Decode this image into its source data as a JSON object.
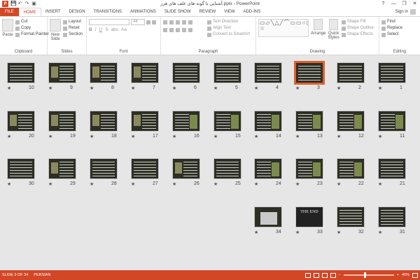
{
  "window": {
    "title": "آشنایی با گونه های علف های هرز.pptx - PowerPoint",
    "help": "?",
    "minimize": "—",
    "restore": "❐",
    "close": "✕"
  },
  "qat": {
    "save": "💾",
    "undo": "↶",
    "redo": "↷",
    "present": "▣"
  },
  "tabs": [
    "FILE",
    "HOME",
    "INSERT",
    "DESIGN",
    "TRANSITIONS",
    "ANIMATIONS",
    "SLIDE SHOW",
    "REVIEW",
    "VIEW",
    "ADD-INS"
  ],
  "active_tab": "HOME",
  "account": {
    "label": "Sign in"
  },
  "ribbon": {
    "clipboard": {
      "label": "Clipboard",
      "paste": "Paste",
      "cut": "Cut",
      "copy": "Copy",
      "format_painter": "Format Painter"
    },
    "slides": {
      "label": "Slides",
      "new_slide_1": "New",
      "new_slide_2": "Slide",
      "layout": "Layout",
      "reset": "Reset",
      "section": "Section"
    },
    "font": {
      "label": "Font",
      "size": "44",
      "bold": "B",
      "italic": "I",
      "underline": "U",
      "strike": "S",
      "abc": "abc",
      "aa": "Aa"
    },
    "paragraph": {
      "label": "Paragraph",
      "text_direction": "Text Direction",
      "align_text": "Align Text",
      "smartart": "Convert to SmartArt"
    },
    "drawing": {
      "label": "Drawing",
      "arrange": "Arrange",
      "quick_1": "Quick",
      "quick_2": "Styles",
      "shape_fill": "Shape Fill",
      "shape_outline": "Shape Outline",
      "shape_effects": "Shape Effects",
      "shapes_gallery": "▭▱╲△╱⌒▭▭○◻▷⇨⟶{}☆"
    },
    "editing": {
      "label": "Editing",
      "find": "Find",
      "replace": "Replace",
      "select": "Select"
    }
  },
  "slide_sorter": {
    "rows": [
      [
        10,
        9,
        8,
        7,
        6,
        5,
        4,
        3,
        2,
        1
      ],
      [
        20,
        19,
        18,
        17,
        16,
        15,
        14,
        13,
        12,
        11
      ],
      [
        30,
        29,
        28,
        27,
        26,
        25,
        24,
        23,
        22,
        21
      ],
      [
        34,
        33,
        32,
        31
      ]
    ],
    "selected": 3,
    "end_text": "THE END",
    "star": "★"
  },
  "status": {
    "slide_info": "SLIDE 3 OF 34",
    "language": "PERSIAN",
    "zoom": "40%",
    "zoom_level": 0.4,
    "minus": "−",
    "plus": "+"
  }
}
